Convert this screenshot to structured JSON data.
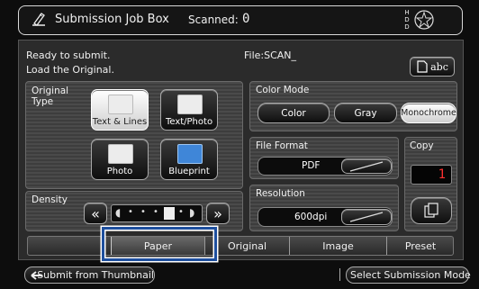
{
  "title_bar": {
    "title": "Submission Job Box",
    "scanned_label": "Scanned:",
    "scanned_value": "0",
    "hdd_label": "HDD"
  },
  "status": {
    "line1": "Ready to submit.",
    "line2": "Load the Original.",
    "file_label": "File:SCAN_",
    "abc_button": "abc"
  },
  "original_type": {
    "label": "Original\nType",
    "options": [
      "Text & Lines",
      "Text/Photo",
      "Photo",
      "Blueprint"
    ],
    "selected": "Text & Lines"
  },
  "color_mode": {
    "label": "Color Mode",
    "options": [
      "Color",
      "Gray",
      "Monochrome"
    ],
    "selected": "Monochrome"
  },
  "file_format": {
    "label": "File Format",
    "value": "PDF"
  },
  "copy": {
    "label": "Copy",
    "value": "1"
  },
  "density": {
    "label": "Density",
    "levels": 7,
    "selected_level": 5,
    "left_arrow": "«",
    "right_arrow": "»"
  },
  "resolution": {
    "label": "Resolution",
    "value": "600dpi"
  },
  "tabs": [
    {
      "label": "Paper",
      "selected": true
    },
    {
      "label": "Original",
      "selected": false
    },
    {
      "label": "Image",
      "selected": false
    },
    {
      "label": "Preset",
      "selected": false
    }
  ],
  "bottom": {
    "submit_thumbnail": "Submit from Thumbnail",
    "select_mode": "Select Submission Mode"
  },
  "colors": {
    "highlight": "#1e4f9e",
    "copy_digit": "#ff3030",
    "accent_blue": "#3f86d8"
  }
}
